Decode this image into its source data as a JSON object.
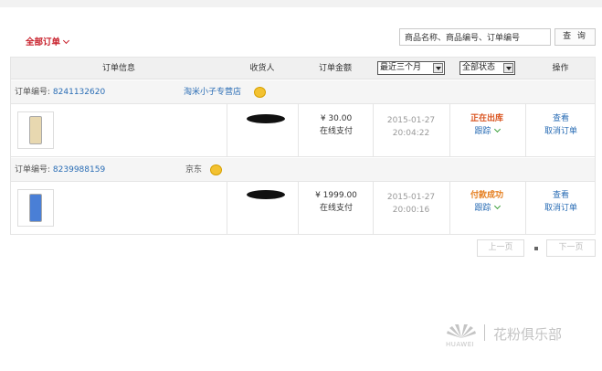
{
  "filter": {
    "label": "全部订单"
  },
  "search": {
    "placeholder": "商品名称、商品编号、订单编号",
    "value": "商品名称、商品编号、订单编号",
    "button": "查 询"
  },
  "table": {
    "headers": {
      "info": "订单信息",
      "receiver": "收货人",
      "amount": "订单金额",
      "period": "最近三个月",
      "status": "全部状态",
      "ops": "操作"
    }
  },
  "orders": [
    {
      "label": "订单编号:",
      "number": "8241132620",
      "store": "淘米小子专营店",
      "price": "¥ 30.00",
      "pay": "在线支付",
      "date": "2015-01-27",
      "time": "20:04:22",
      "status": "正在出库",
      "status_color": "#d9531e",
      "track": "跟踪",
      "view": "查看",
      "cancel": "取消订单"
    },
    {
      "label": "订单编号:",
      "number": "8239988159",
      "store": "京东",
      "price": "¥ 1999.00",
      "pay": "在线支付",
      "date": "2015-01-27",
      "time": "20:00:16",
      "status": "付款成功",
      "status_color": "#e57e1e",
      "track": "跟踪",
      "view": "查看",
      "cancel": "取消订单"
    }
  ],
  "pager": {
    "prev": "上一页",
    "next": "下一页"
  },
  "watermark": {
    "brand": "HUAWEI",
    "text": "花粉俱乐部"
  }
}
